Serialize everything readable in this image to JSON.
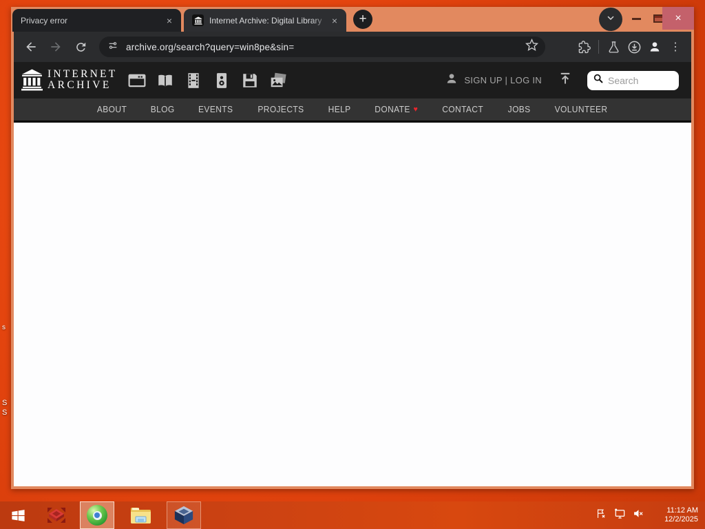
{
  "browser": {
    "tabs": [
      {
        "title": "Privacy error"
      },
      {
        "title": "Internet Archive: Digital Library"
      }
    ],
    "url": "archive.org/search?query=win8pe&sin="
  },
  "glyphs": {
    "close": "×",
    "plus": "+",
    "kebab": "⋮",
    "heart": "♥"
  },
  "ia_header": {
    "logo_line1": "INTERNET",
    "logo_line2": "ARCHIVE",
    "auth_text": "SIGN UP | LOG IN",
    "search_placeholder": "Search"
  },
  "nav": {
    "items": [
      {
        "label": "ABOUT"
      },
      {
        "label": "BLOG"
      },
      {
        "label": "EVENTS"
      },
      {
        "label": "PROJECTS"
      },
      {
        "label": "HELP"
      },
      {
        "label": "DONATE"
      },
      {
        "label": "CONTACT"
      },
      {
        "label": "JOBS"
      },
      {
        "label": "VOLUNTEER"
      }
    ]
  },
  "desktop": {
    "fragments": [
      {
        "text": "s"
      },
      {
        "text": "S"
      },
      {
        "text": "S"
      }
    ]
  },
  "taskbar": {
    "time": "11:12 AM",
    "date": "12/2/2025"
  },
  "icons": {
    "ia-building-icon": "greek temple columns",
    "web-icon": "browser window",
    "texts-icon": "open book",
    "video-icon": "film strip",
    "audio-icon": "speaker box",
    "software-icon": "floppy disk",
    "images-icon": "photo stack",
    "user-icon": "person silhouette",
    "upload-icon": "arrow up with bar",
    "search-icon": "magnifier",
    "back-icon": "arrow left",
    "forward-icon": "arrow right",
    "refresh-icon": "circular arrow",
    "site-info-icon": "tune sliders",
    "bookmark-star-icon": "star outline",
    "extensions-icon": "puzzle piece",
    "labs-icon": "flask",
    "download-icon": "circled down arrow",
    "profile-icon": "person",
    "menu-icon": "three vertical dots",
    "tab-search-icon": "chevron down",
    "minimize-icon": "dash",
    "maximize-icon": "window frame",
    "close-icon": "x",
    "start-icon": "windows logo",
    "red-box-app-icon": "red parcel with arrows",
    "browser-ball-icon": "green sphere blue core",
    "file-explorer-icon": "yellow folder",
    "virtualbox-icon": "blue cube",
    "action-center-icon": "flag with x",
    "network-icon": "monitor with connector",
    "volume-icon": "muted speaker"
  },
  "colors": {
    "desktop_orange": "#e2430e",
    "frame_salmon": "#e2895f",
    "tab_inactive": "#1f2023",
    "tab_active": "#2d2e31",
    "toolbar": "#2b2c2e",
    "urlbar": "#1e1f21",
    "ia_header": "#1c1c1c",
    "ia_nav": "#333333",
    "donate_heart": "#e8262d",
    "close_button": "#c4616b",
    "taskbar_red": "#cc4212",
    "content": "#fdfdfe"
  }
}
